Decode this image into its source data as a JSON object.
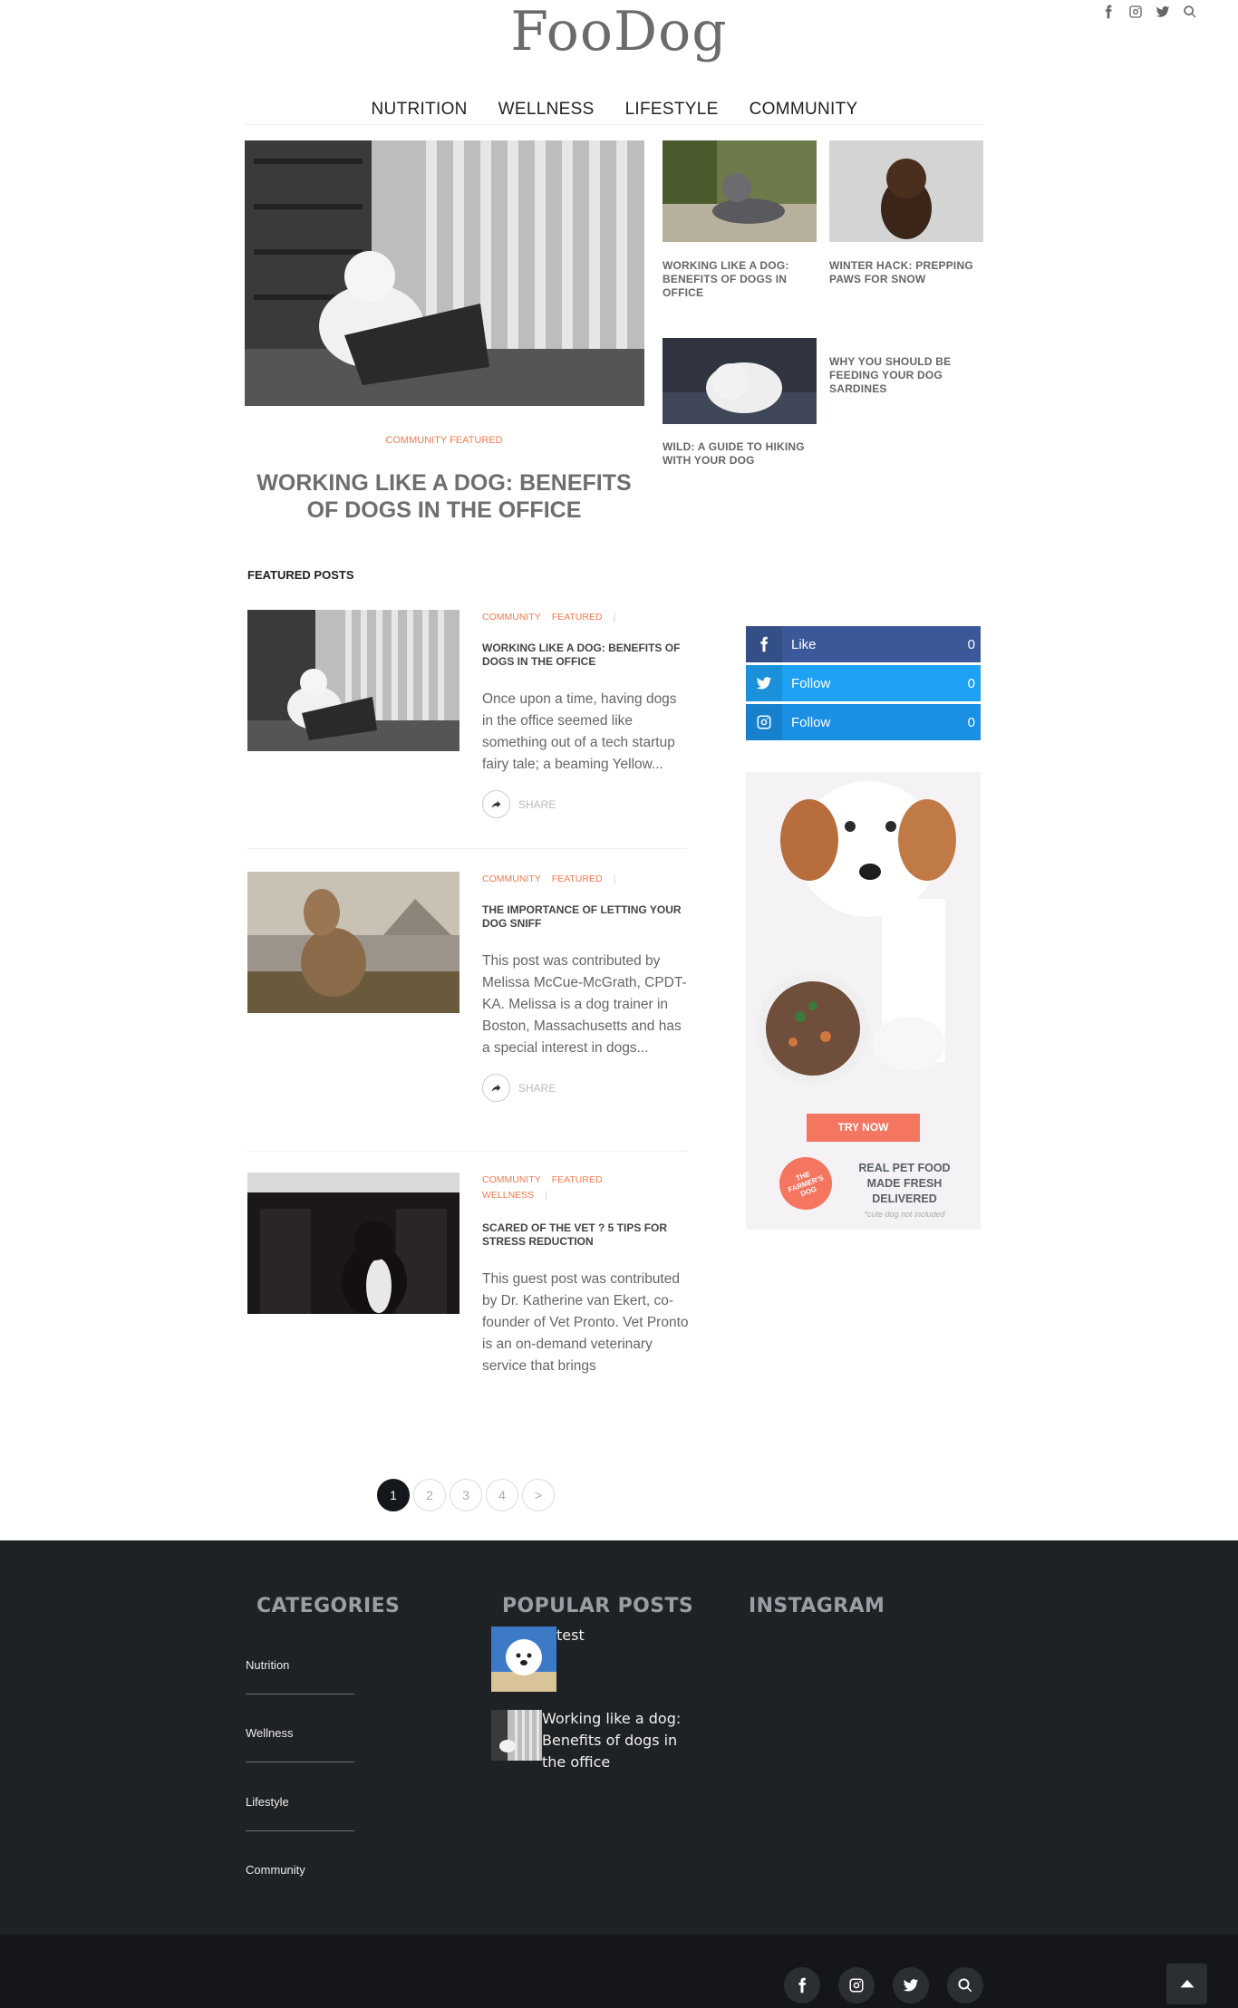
{
  "site": {
    "logo": "FooDog"
  },
  "header_icons": [
    "facebook-icon",
    "instagram-icon",
    "twitter-icon",
    "search-icon"
  ],
  "nav": {
    "items": [
      {
        "label": "NUTRITION"
      },
      {
        "label": "WELLNESS"
      },
      {
        "label": "LIFESTYLE"
      },
      {
        "label": "COMMUNITY"
      }
    ]
  },
  "hero": {
    "category": "COMMUNITY FEATURED",
    "title": "WORKING LIKE A DOG: BENEFITS OF DOGS IN THE OFFICE"
  },
  "grid_posts": [
    {
      "title": "WORKING LIKE A DOG: BENEFITS OF DOGS IN OFFICE"
    },
    {
      "title": "WINTER HACK: PREPPING PAWS FOR SNOW"
    },
    {
      "title": "WILD: A GUIDE TO HIKING WITH YOUR DOG"
    },
    {
      "title": "WHY YOU SHOULD BE FEEDING YOUR DOG SARDINES"
    }
  ],
  "featured": {
    "heading": "FEATURED POSTS",
    "share_label": "SHARE",
    "posts": [
      {
        "categories": [
          "COMMUNITY",
          "FEATURED"
        ],
        "title": "WORKING LIKE A DOG: BENEFITS OF DOGS IN THE OFFICE",
        "excerpt": "Once upon a time, having dogs in the office seemed like something out of a tech startup fairy tale; a beaming Yellow..."
      },
      {
        "categories": [
          "COMMUNITY",
          "FEATURED"
        ],
        "title": "THE IMPORTANCE OF LETTING YOUR DOG SNIFF",
        "excerpt": "This post was contributed by Melissa McCue-McGrath, CPDT-KA. Melissa is a dog trainer in Boston, Massachusetts and has a special interest in dogs..."
      },
      {
        "categories": [
          "COMMUNITY",
          "FEATURED",
          "WELLNESS"
        ],
        "title": "SCARED OF THE VET ? 5 TIPS FOR STRESS REDUCTION",
        "excerpt": "This guest post was contributed by Dr. Katherine van Ekert, co-founder of Vet Pronto. Vet Pronto is an on-demand veterinary service that brings"
      }
    ]
  },
  "social": [
    {
      "label": "Like",
      "count": "0",
      "color": "#3b5998"
    },
    {
      "label": "Follow",
      "count": "0",
      "color": "#1da1f2"
    },
    {
      "label": "Follow",
      "count": "0",
      "color": "#1a8fe3"
    }
  ],
  "ad": {
    "cta": "TRY NOW",
    "badge": "THE FARMER'S DOG",
    "tagline": "REAL PET FOOD MADE FRESH DELIVERED",
    "note": "*cute dog not included"
  },
  "pagination": {
    "pages": [
      "1",
      "2",
      "3",
      "4",
      ">"
    ],
    "active": "1"
  },
  "footer": {
    "categories_heading": "CATEGORIES",
    "popular_heading": "POPULAR POSTS",
    "instagram_heading": "INSTAGRAM",
    "categories": [
      "Nutrition",
      "Wellness",
      "Lifestyle",
      "Community"
    ],
    "popular_posts": [
      {
        "title": "test"
      },
      {
        "title": "Working like a dog: Benefits of dogs in the office"
      }
    ]
  },
  "colors": {
    "accent": "#f57a4e",
    "footer_bg": "#1f2225",
    "bottom_bar_bg": "#14161a"
  }
}
